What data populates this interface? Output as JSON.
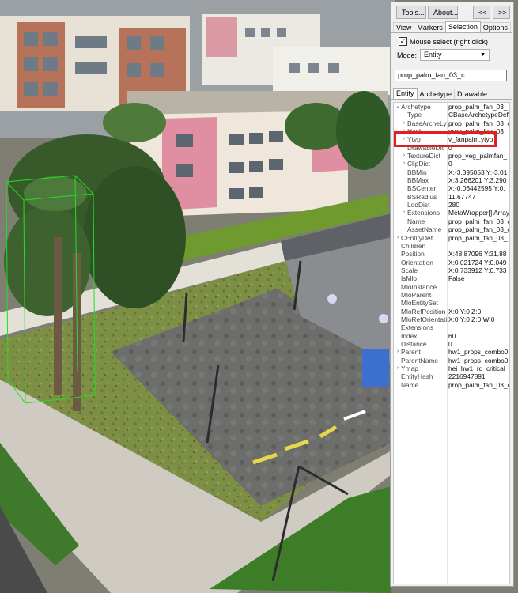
{
  "toolbar": {
    "tools_label": "Tools...",
    "about_label": "About...",
    "collapse_label": "<<",
    "expand_label": ">>"
  },
  "tabs": [
    "View",
    "Markers",
    "Selection",
    "Options"
  ],
  "selection": {
    "mouse_select_label": "Mouse select (right click)",
    "mouse_select_checked": "✓",
    "mode_label": "Mode:",
    "mode_value": "Entity",
    "search_value": "prop_palm_fan_03_c"
  },
  "subtabs": [
    "Entity",
    "Archetype",
    "Drawable"
  ],
  "properties": [
    {
      "name": "Archetype",
      "value": "prop_palm_fan_03_",
      "indent": 0,
      "expander": "⌄",
      "gray": false
    },
    {
      "name": "Type",
      "value": "CBaseArchetypeDef",
      "indent": 1,
      "expander": "",
      "gray": false
    },
    {
      "name": "BaseArcheLy",
      "value": "prop_palm_fan_03_c",
      "indent": 1,
      "expander": "›",
      "gray": false
    },
    {
      "name": "Hash",
      "value": "prop_palm_fan_03",
      "indent": 1,
      "expander": "›",
      "gray": false
    },
    {
      "name": "Ytyp",
      "value": "v_fanpalm.ytyp",
      "indent": 1,
      "expander": "›",
      "gray": false
    },
    {
      "name": "DrawableDic",
      "value": "0",
      "indent": 1,
      "expander": "",
      "gray": false
    },
    {
      "name": "TextureDict",
      "value": "prop_veg_palmfan_",
      "indent": 1,
      "expander": "›",
      "gray": false
    },
    {
      "name": "ClipDict",
      "value": "0",
      "indent": 1,
      "expander": "›",
      "gray": false
    },
    {
      "name": "BBMin",
      "value": "X:-3.395053 Y:-3.01",
      "indent": 1,
      "expander": "",
      "gray": false
    },
    {
      "name": "BBMax",
      "value": "X:3.266201 Y:3.290",
      "indent": 1,
      "expander": "",
      "gray": false
    },
    {
      "name": "BSCenter",
      "value": "X:-0.06442595 Y:0.",
      "indent": 1,
      "expander": "",
      "gray": false
    },
    {
      "name": "BSRadius",
      "value": "11.67747",
      "indent": 1,
      "expander": "",
      "gray": false
    },
    {
      "name": "LodDist",
      "value": "280",
      "indent": 1,
      "expander": "",
      "gray": false
    },
    {
      "name": "Extensions",
      "value": "MetaWrapper[] Array",
      "indent": 1,
      "expander": "›",
      "gray": false
    },
    {
      "name": "Name",
      "value": "prop_palm_fan_03_c",
      "indent": 1,
      "expander": "",
      "gray": false
    },
    {
      "name": "AssetName",
      "value": "prop_palm_fan_03_c",
      "indent": 1,
      "expander": "",
      "gray": false
    },
    {
      "name": "CEntityDef",
      "value": "prop_palm_fan_03_",
      "indent": 0,
      "expander": "›",
      "gray": false
    },
    {
      "name": "Children",
      "value": "",
      "indent": 0,
      "expander": "",
      "gray": false
    },
    {
      "name": "Position",
      "value": "X:48.87096 Y:31.88",
      "indent": 0,
      "expander": "",
      "gray": false
    },
    {
      "name": "Orientation",
      "value": "X:0.021724 Y:0.049",
      "indent": 0,
      "expander": "",
      "gray": false
    },
    {
      "name": "Scale",
      "value": "X:0.733912 Y:0.733",
      "indent": 0,
      "expander": "",
      "gray": false
    },
    {
      "name": "IsMlo",
      "value": "False",
      "indent": 0,
      "expander": "",
      "gray": false
    },
    {
      "name": "MloInstance",
      "value": "",
      "indent": 0,
      "expander": "",
      "gray": false
    },
    {
      "name": "MloParent",
      "value": "",
      "indent": 0,
      "expander": "",
      "gray": false
    },
    {
      "name": "MloEntitySet",
      "value": "",
      "indent": 0,
      "expander": "",
      "gray": false
    },
    {
      "name": "MloRefPosition",
      "value": "X:0 Y:0 Z:0",
      "indent": 0,
      "expander": "",
      "gray": false
    },
    {
      "name": "MloRefOrientati",
      "value": "X:0 Y:0 Z:0 W:0",
      "indent": 0,
      "expander": "",
      "gray": false
    },
    {
      "name": "Extensions",
      "value": "",
      "indent": 0,
      "expander": "",
      "gray": false
    },
    {
      "name": "Index",
      "value": "60",
      "indent": 0,
      "expander": "",
      "gray": false
    },
    {
      "name": "Distance",
      "value": "0",
      "indent": 0,
      "expander": "",
      "gray": false
    },
    {
      "name": "Parent",
      "value": "hw1_props_combo0",
      "indent": 0,
      "expander": "›",
      "gray": false
    },
    {
      "name": "ParentName",
      "value": "hw1_props_combo0",
      "indent": 0,
      "expander": "",
      "gray": false
    },
    {
      "name": "Ymap",
      "value": "hei_hw1_rd_critical_",
      "indent": 0,
      "expander": "›",
      "gray": false
    },
    {
      "name": "EntityHash",
      "value": "2216947891",
      "indent": 0,
      "expander": "",
      "gray": false
    },
    {
      "name": "Name",
      "value": "prop_palm_fan_03_c",
      "indent": 0,
      "expander": "",
      "gray": false
    }
  ],
  "colors": {
    "highlight_border": "#e02020",
    "panel_bg": "#f0f0f0",
    "asphalt": "#5a5a5a",
    "grass": "#6f8f3a"
  }
}
